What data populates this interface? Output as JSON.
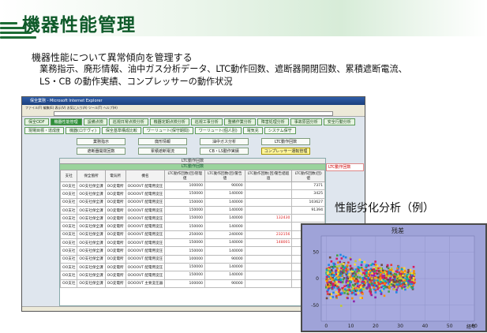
{
  "slide": {
    "title": "機器性能管理",
    "line1": "機器性能について異常傾向を管理する",
    "line2": "業務指示、廃形情報、油中ガス分析データ、LTC動作回数、遮断器開閉回数、累積遮断電流、",
    "line3": "LS・CB の動作実績、コンプレッサーの動作状況",
    "caption": "性能劣化分析（例）"
  },
  "app": {
    "window_title": "保全業務 - Microsoft Internet Explorer",
    "menu": "ファイル(F)  編集(E)  表示(V)  お気に入り(A)  ツール(T)  ヘルプ(H)",
    "tabs1": [
      "保全ODF",
      "機器性能管理",
      "設備点検",
      "巡視日常点検分析",
      "機器定期点検分析",
      "巡視工事分析",
      "整備作業分析",
      "障害処理分析",
      "事故原因分析",
      "安全行動分析"
    ],
    "tabs2": [
      "現場目標・達成度",
      "機器(ロケヴィ)",
      "保全基準構成比較",
      "ワーリュート(保守期間)",
      "ワーリュート(個人別)",
      "電気充",
      "システム保守"
    ],
    "buttons1": [
      "業務指示",
      "廃形情報",
      "油中ガス分析",
      "LTC動作回数"
    ],
    "buttons2": [
      "遮断器開閉回数",
      "累積遮断電流",
      "CB・LS動作実績",
      "コンプレッサー運転管理"
    ],
    "grid_title": "LTC動作回数",
    "grid_subtitle": "LTC動作回数",
    "side_label": "LTC動作回数",
    "columns": [
      "支社",
      "保全箇所",
      "電気所",
      "機名",
      "LTC動作回数(回)管理値",
      "LTC動作回数(回)警告値",
      "LTC動作回数(回)警告値超過",
      "LTC動作回数(回)値"
    ],
    "rows": [
      [
        "OO支社",
        "OO支社保全課",
        "OO変電所",
        "OOOOVT 配電用変圧",
        "100000",
        "90000",
        "",
        "7371"
      ],
      [
        "OO支社",
        "OO支社保全課",
        "OO変電所",
        "OOOOVT 配電用変圧",
        "150000",
        "140000",
        "",
        "3425"
      ],
      [
        "OO支社",
        "OO支社保全課",
        "OO変電所",
        "OOOOVT 配電用変圧",
        "150000",
        "140000",
        "",
        "103627"
      ],
      [
        "OO支社",
        "OO支社保全課",
        "OO変電所",
        "OOOOVT 配電用変圧",
        "150000",
        "140000",
        "",
        "91394"
      ],
      [
        "OO支社",
        "OO支社保全課",
        "OO変電所",
        "OOOOVT 配電用変圧",
        "150000",
        "140000",
        "132430",
        ""
      ],
      [
        "OO支社",
        "OO支社保全課",
        "OO変電所",
        "OOOOVT 配電用変圧",
        "150000",
        "140000",
        "",
        ""
      ],
      [
        "OO支社",
        "OO支社保全課",
        "OO変電所",
        "OOOOVT 配電用変圧",
        "250000",
        "240000",
        "232156",
        ""
      ],
      [
        "OO支社",
        "OO支社保全課",
        "OO変電所",
        "OOOOVT 配電用変圧",
        "150000",
        "140000",
        "148001",
        ""
      ],
      [
        "OO支社",
        "OO支社保全課",
        "OO変電所",
        "OOOOVT 配電用変圧",
        "150000",
        "140000",
        "",
        ""
      ],
      [
        "OO支社",
        "OO支社保全課",
        "OO変電所",
        "OOOOVT 配電用変圧",
        "100000",
        "90000",
        "",
        ""
      ],
      [
        "OO支社",
        "OO支社保全課",
        "OO変電所",
        "OOOOVT 配電用変圧",
        "150000",
        "140000",
        "",
        ""
      ],
      [
        "OO支社",
        "OO支社保全課",
        "OO変電所",
        "OOOOVT 配電用変圧",
        "150000",
        "140000",
        "",
        ""
      ],
      [
        "OO支社",
        "OO支社保全課",
        "OO変電所",
        "OOOOVT 主要変圧器",
        "100000",
        "90000",
        "",
        ""
      ]
    ]
  },
  "chart_data": {
    "type": "scatter",
    "title": "残差",
    "xlabel": "経年",
    "x_ticks": [
      "0",
      "10",
      "20",
      "30",
      "40",
      "50",
      "60"
    ],
    "y_ticks": [
      "50",
      "0",
      "-50"
    ],
    "xlim": [
      -2,
      60
    ],
    "ylim": [
      -80,
      80
    ],
    "grid": true
  }
}
